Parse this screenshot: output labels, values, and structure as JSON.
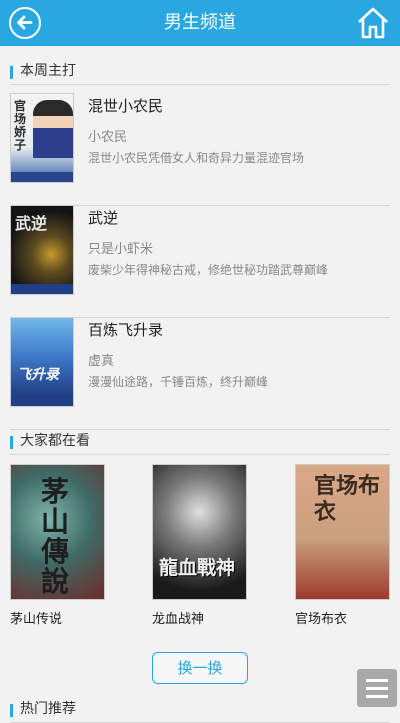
{
  "header": {
    "title": "男生频道",
    "back_icon": "back-arrow-circle-icon",
    "home_icon": "home-icon",
    "color": "#29a7e1"
  },
  "weekly_section": {
    "label": "本周主打",
    "books": [
      {
        "title": "混世小农民",
        "author": "小农民",
        "desc": "混世小农民凭借女人和奇异力量混迹官场",
        "cover_text": "官场娇子"
      },
      {
        "title": "武逆",
        "author": "只是小虾米",
        "desc": "废柴少年得神秘古戒，修绝世秘功踏武尊巅峰",
        "cover_text": "武逆"
      },
      {
        "title": "百炼飞升录",
        "author": "虚真",
        "desc": "漫漫仙途路，千锤百炼，终升巅峰",
        "cover_text": "飞升录"
      }
    ]
  },
  "popular_section": {
    "label": "大家都在看",
    "books": [
      {
        "title": "茅山传说",
        "cover_text": "茅山傳說"
      },
      {
        "title": "龙血战神",
        "cover_text": "龍血戰神"
      },
      {
        "title": "官场布衣",
        "cover_text": "官场布衣"
      }
    ],
    "refresh_label": "换一换"
  },
  "hot_section": {
    "label": "热门推荐"
  },
  "fab": {
    "icon": "menu-icon"
  }
}
